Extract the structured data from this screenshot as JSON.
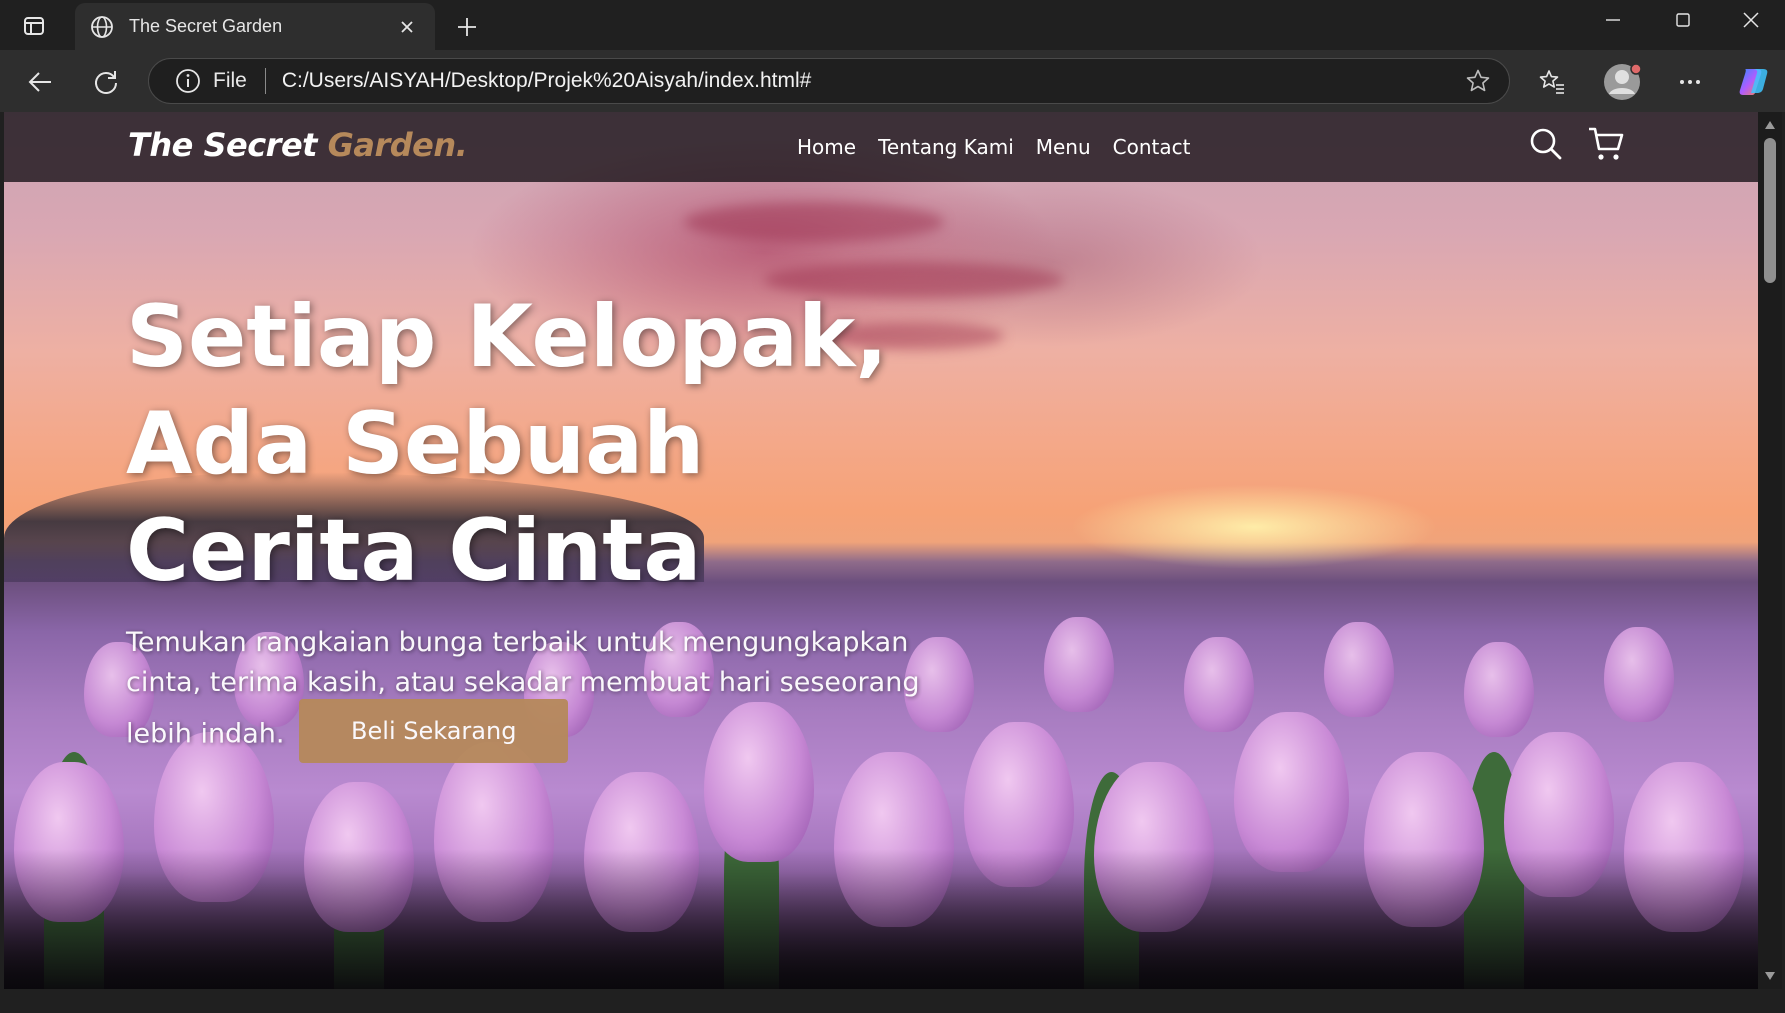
{
  "browser": {
    "tab": {
      "title": "The Secret Garden",
      "favicon": "globe-icon"
    },
    "address": {
      "scheme": "File",
      "url": "C:/Users/AISYAH/Desktop/Projek%20Aisyah/index.html#"
    },
    "icons": [
      "tab-actions-icon",
      "close-icon",
      "plus-icon",
      "minimize-icon",
      "maximize-icon",
      "window-close-icon",
      "back-icon",
      "refresh-icon",
      "info-icon",
      "star-icon",
      "favorites-icon",
      "profile-icon",
      "more-icon",
      "copilot-icon"
    ]
  },
  "site": {
    "brand": {
      "main": "The Secret ",
      "accent": "Garden."
    },
    "nav": [
      "Home",
      "Tentang Kami",
      "Menu",
      "Contact"
    ],
    "icons": [
      "search-icon",
      "cart-icon"
    ],
    "hero": {
      "title_lines": [
        "Setiap Kelopak,",
        "Ada Sebuah",
        "Cerita Cinta"
      ],
      "description": "Temukan rangkaian bunga terbaik untuk mengungkapkan cinta, terima kasih, atau sekadar membuat hari seseorang lebih indah.",
      "cta": "Beli Sekarang"
    }
  },
  "colors": {
    "accent": "#b6895b",
    "chrome_bg": "#202020",
    "toolbar_bg": "#2e2e2e"
  }
}
